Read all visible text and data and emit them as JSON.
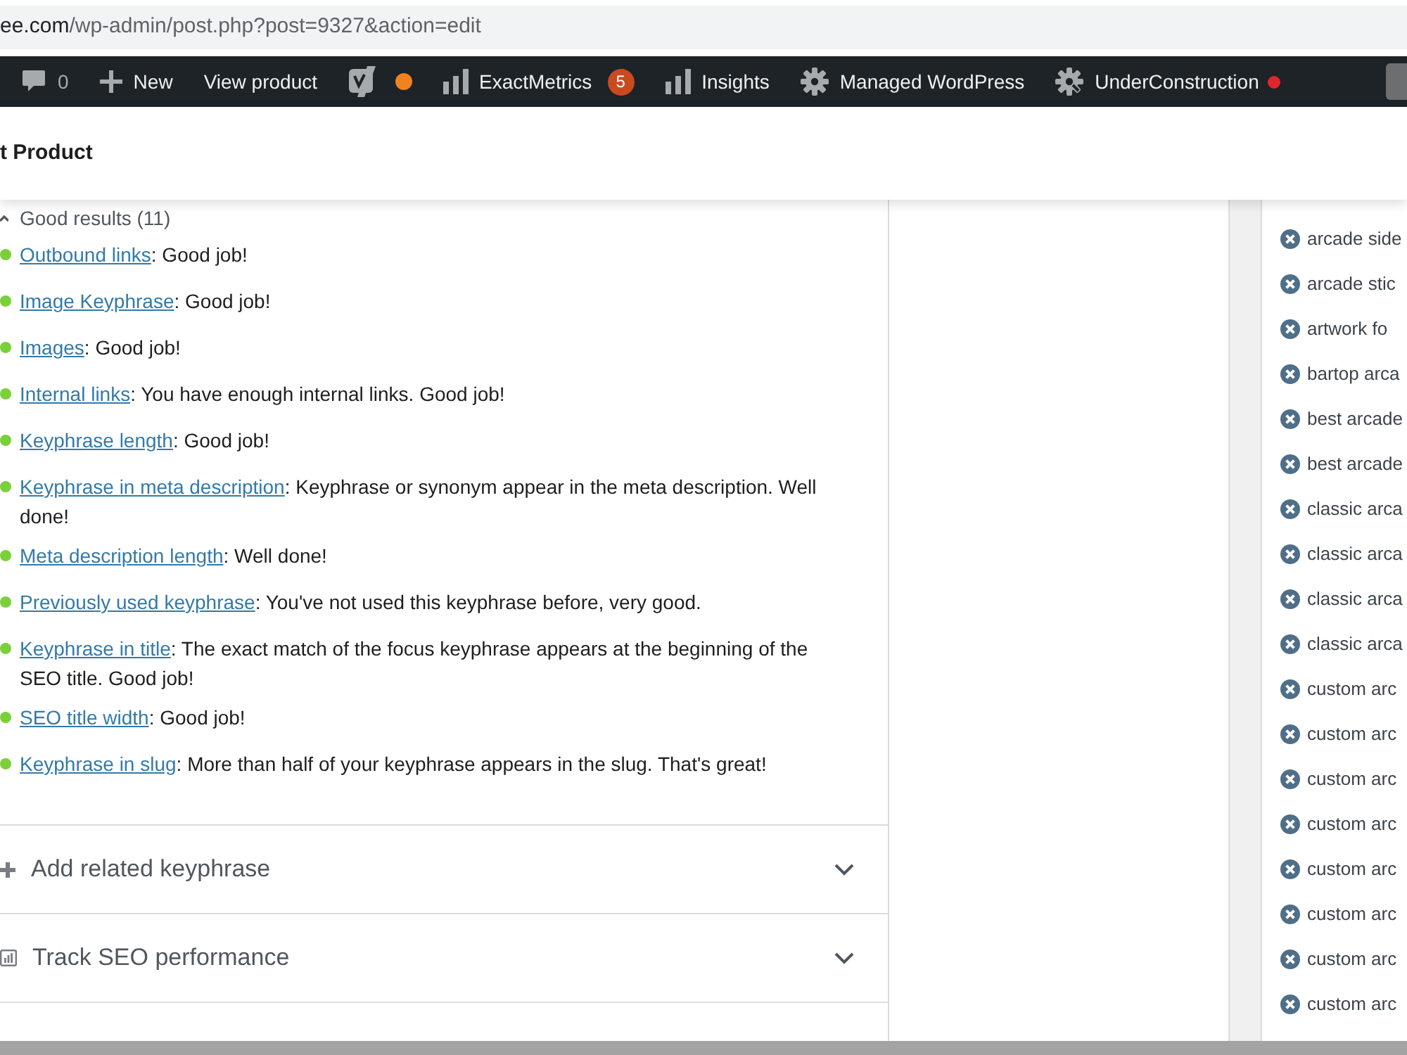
{
  "browser": {
    "url_host": "ee.com",
    "url_path": "/wp-admin/post.php?post=9327&action=edit"
  },
  "admin_bar": {
    "items": [
      {
        "kind": "comments",
        "label": "0"
      },
      {
        "kind": "new",
        "label": "New"
      },
      {
        "kind": "link",
        "label": "View product"
      },
      {
        "kind": "seo",
        "color": "#f0831e"
      },
      {
        "kind": "stats",
        "label": "ExactMetrics",
        "badge": "5"
      },
      {
        "kind": "stats",
        "label": "Insights"
      },
      {
        "kind": "hosting",
        "label": "Managed WordPress"
      },
      {
        "kind": "maintenance",
        "label": "UnderConstruction",
        "color": "#e0262d"
      },
      {
        "kind": "account"
      }
    ]
  },
  "page_header": {
    "title": "t Product"
  },
  "seo_panel": {
    "section_title": "Good results (11)",
    "results": [
      {
        "link": "Outbound links",
        "text": ": Good job!"
      },
      {
        "link": "Image Keyphrase",
        "text": ": Good job!"
      },
      {
        "link": "Images",
        "text": ": Good job!"
      },
      {
        "link": "Internal links",
        "text": ": You have enough internal links. Good job!"
      },
      {
        "link": "Keyphrase length",
        "text": ": Good job!"
      },
      {
        "link": "Keyphrase in meta description",
        "text": ": Keyphrase or synonym appear in the meta description. Well done!"
      },
      {
        "link": "Meta description length",
        "text": ": Well done!"
      },
      {
        "link": "Previously used keyphrase",
        "text": ": You've not used this keyphrase before, very good."
      },
      {
        "link": "Keyphrase in title",
        "text": ": The exact match of the focus keyphrase appears at the beginning of the SEO title. Good job!"
      },
      {
        "link": "SEO title width",
        "text": ": Good job!"
      },
      {
        "link": "Keyphrase in slug",
        "text": ": More than half of your keyphrase appears in the slug. That's great!"
      }
    ],
    "accordions": [
      {
        "kind": "add",
        "label": "Add related keyphrase",
        "expanded": false
      },
      {
        "kind": "track",
        "label": "Track SEO performance",
        "expanded": false
      }
    ]
  },
  "tags": [
    "arcade side",
    "arcade stic",
    "artwork fo",
    "bartop arca",
    "best arcade",
    "best arcade",
    "classic arca",
    "classic arca",
    "classic arca",
    "classic arca",
    "custom arc",
    "custom arc",
    "custom arc",
    "custom arc",
    "custom arc",
    "custom arc",
    "custom arc",
    "custom arc"
  ]
}
